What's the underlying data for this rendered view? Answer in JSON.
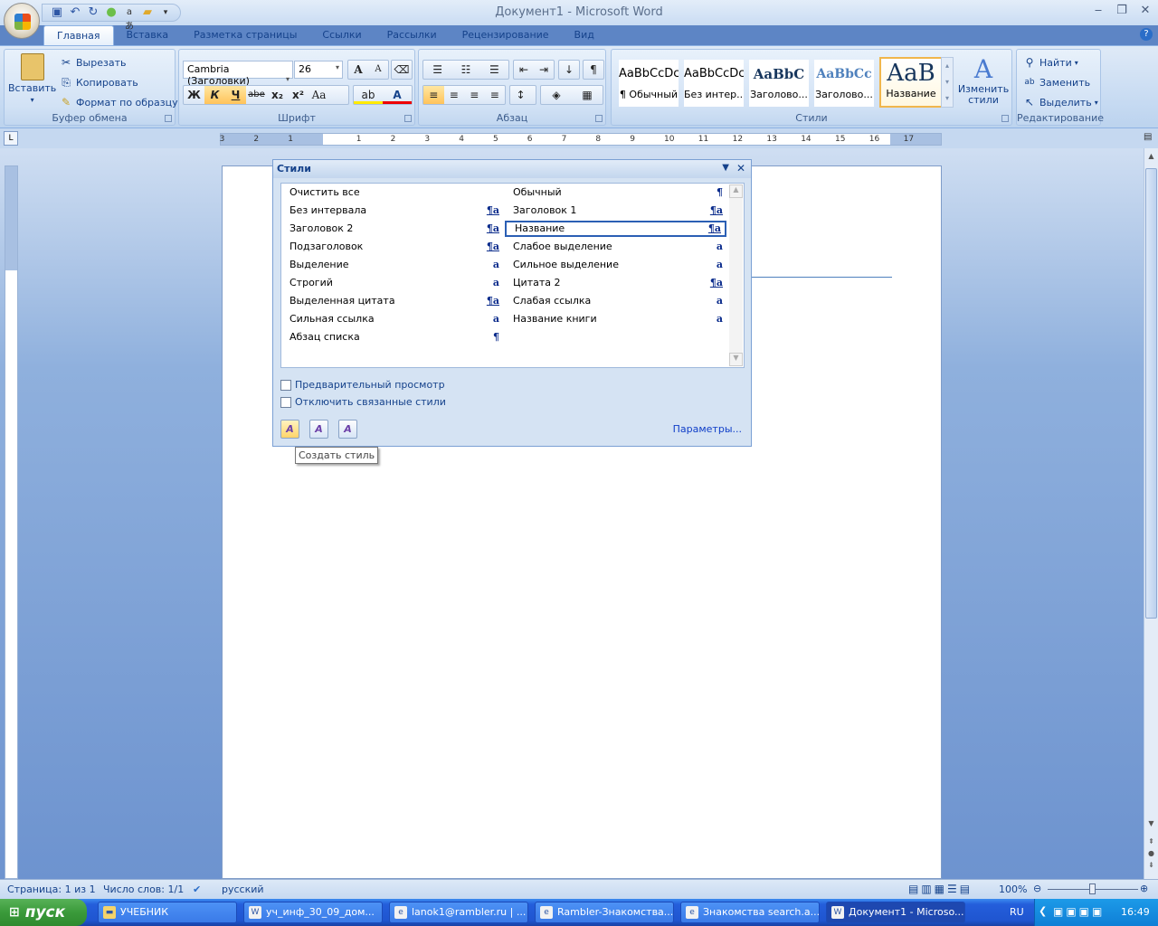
{
  "window": {
    "title": "Документ1 - Microsoft Word",
    "minimize": "‒",
    "restore": "❐",
    "close": "✕"
  },
  "tabs": [
    "Главная",
    "Вставка",
    "Разметка страницы",
    "Ссылки",
    "Рассылки",
    "Рецензирование",
    "Вид"
  ],
  "clipboard": {
    "paste": "Вставить",
    "cut": "Вырезать",
    "copy": "Копировать",
    "format_painter": "Формат по образцу",
    "label": "Буфер обмена"
  },
  "font": {
    "name": "Cambria (Заголовки)",
    "size": "26",
    "label": "Шрифт",
    "bold": "Ж",
    "italic": "К",
    "underline": "Ч",
    "strike": "abe",
    "sub": "x₂",
    "sup": "x²",
    "case": "Aa",
    "grow": "A",
    "shrink": "A"
  },
  "paragraph": {
    "label": "Абзац"
  },
  "styles": {
    "label": "Стили",
    "change": "Изменить стили",
    "gallery": [
      {
        "sample": "AaBbCcDc",
        "name": "¶ Обычный"
      },
      {
        "sample": "AaBbCcDc",
        "name": "Без интер..."
      },
      {
        "sample": "AaBbC",
        "name": "Заголово..."
      },
      {
        "sample": "AaBbCc",
        "name": "Заголово..."
      },
      {
        "sample": "AaB",
        "name": "Название"
      }
    ]
  },
  "editing": {
    "label": "Редактирование",
    "find": "Найти",
    "replace": "Заменить",
    "select": "Выделить"
  },
  "ruler": {
    "left": [
      "3",
      "2",
      "1"
    ],
    "right": [
      "1",
      "2",
      "3",
      "4",
      "5",
      "6",
      "7",
      "8",
      "9",
      "10",
      "11",
      "12",
      "13",
      "14",
      "15",
      "16",
      "17"
    ]
  },
  "pane": {
    "title": "Стили",
    "left": [
      {
        "name": "Очистить все",
        "mark": ""
      },
      {
        "name": "Без интервала",
        "mark": "¶a"
      },
      {
        "name": "Заголовок 2",
        "mark": "¶a"
      },
      {
        "name": "Подзаголовок",
        "mark": "¶a"
      },
      {
        "name": "Выделение",
        "mark": "a"
      },
      {
        "name": "Строгий",
        "mark": "a"
      },
      {
        "name": "Выделенная цитата",
        "mark": "¶a"
      },
      {
        "name": "Сильная ссылка",
        "mark": "a"
      },
      {
        "name": "Абзац списка",
        "mark": "¶"
      }
    ],
    "right": [
      {
        "name": "Обычный",
        "mark": "¶"
      },
      {
        "name": "Заголовок 1",
        "mark": "¶a"
      },
      {
        "name": "Название",
        "mark": "¶a",
        "selected": true
      },
      {
        "name": "Слабое выделение",
        "mark": "a"
      },
      {
        "name": "Сильное выделение",
        "mark": "a"
      },
      {
        "name": "Цитата 2",
        "mark": "¶a"
      },
      {
        "name": "Слабая ссылка",
        "mark": "a"
      },
      {
        "name": "Название книги",
        "mark": "a"
      }
    ],
    "preview": "Предварительный просмотр",
    "disable_linked": "Отключить связанные стили",
    "options": "Параметры...",
    "tooltip": "Создать стиль"
  },
  "status": {
    "page": "Страница: 1 из 1",
    "words": "Число слов: 1/1",
    "lang": "русский",
    "zoom": "100%"
  },
  "taskbar": {
    "start": "пуск",
    "items": [
      {
        "label": "УЧЕБНИК",
        "icon": "folder"
      },
      {
        "label": "уч_инф_30_09_дом...",
        "icon": "word"
      },
      {
        "label": "lanok1@rambler.ru | ...",
        "icon": "ie"
      },
      {
        "label": "Rambler-Знакомства...",
        "icon": "ie"
      },
      {
        "label": "Знакомства search.a...",
        "icon": "ie"
      },
      {
        "label": "Документ1 - Microso...",
        "icon": "word",
        "active": true
      }
    ],
    "lang": "RU",
    "clock": "16:49"
  }
}
